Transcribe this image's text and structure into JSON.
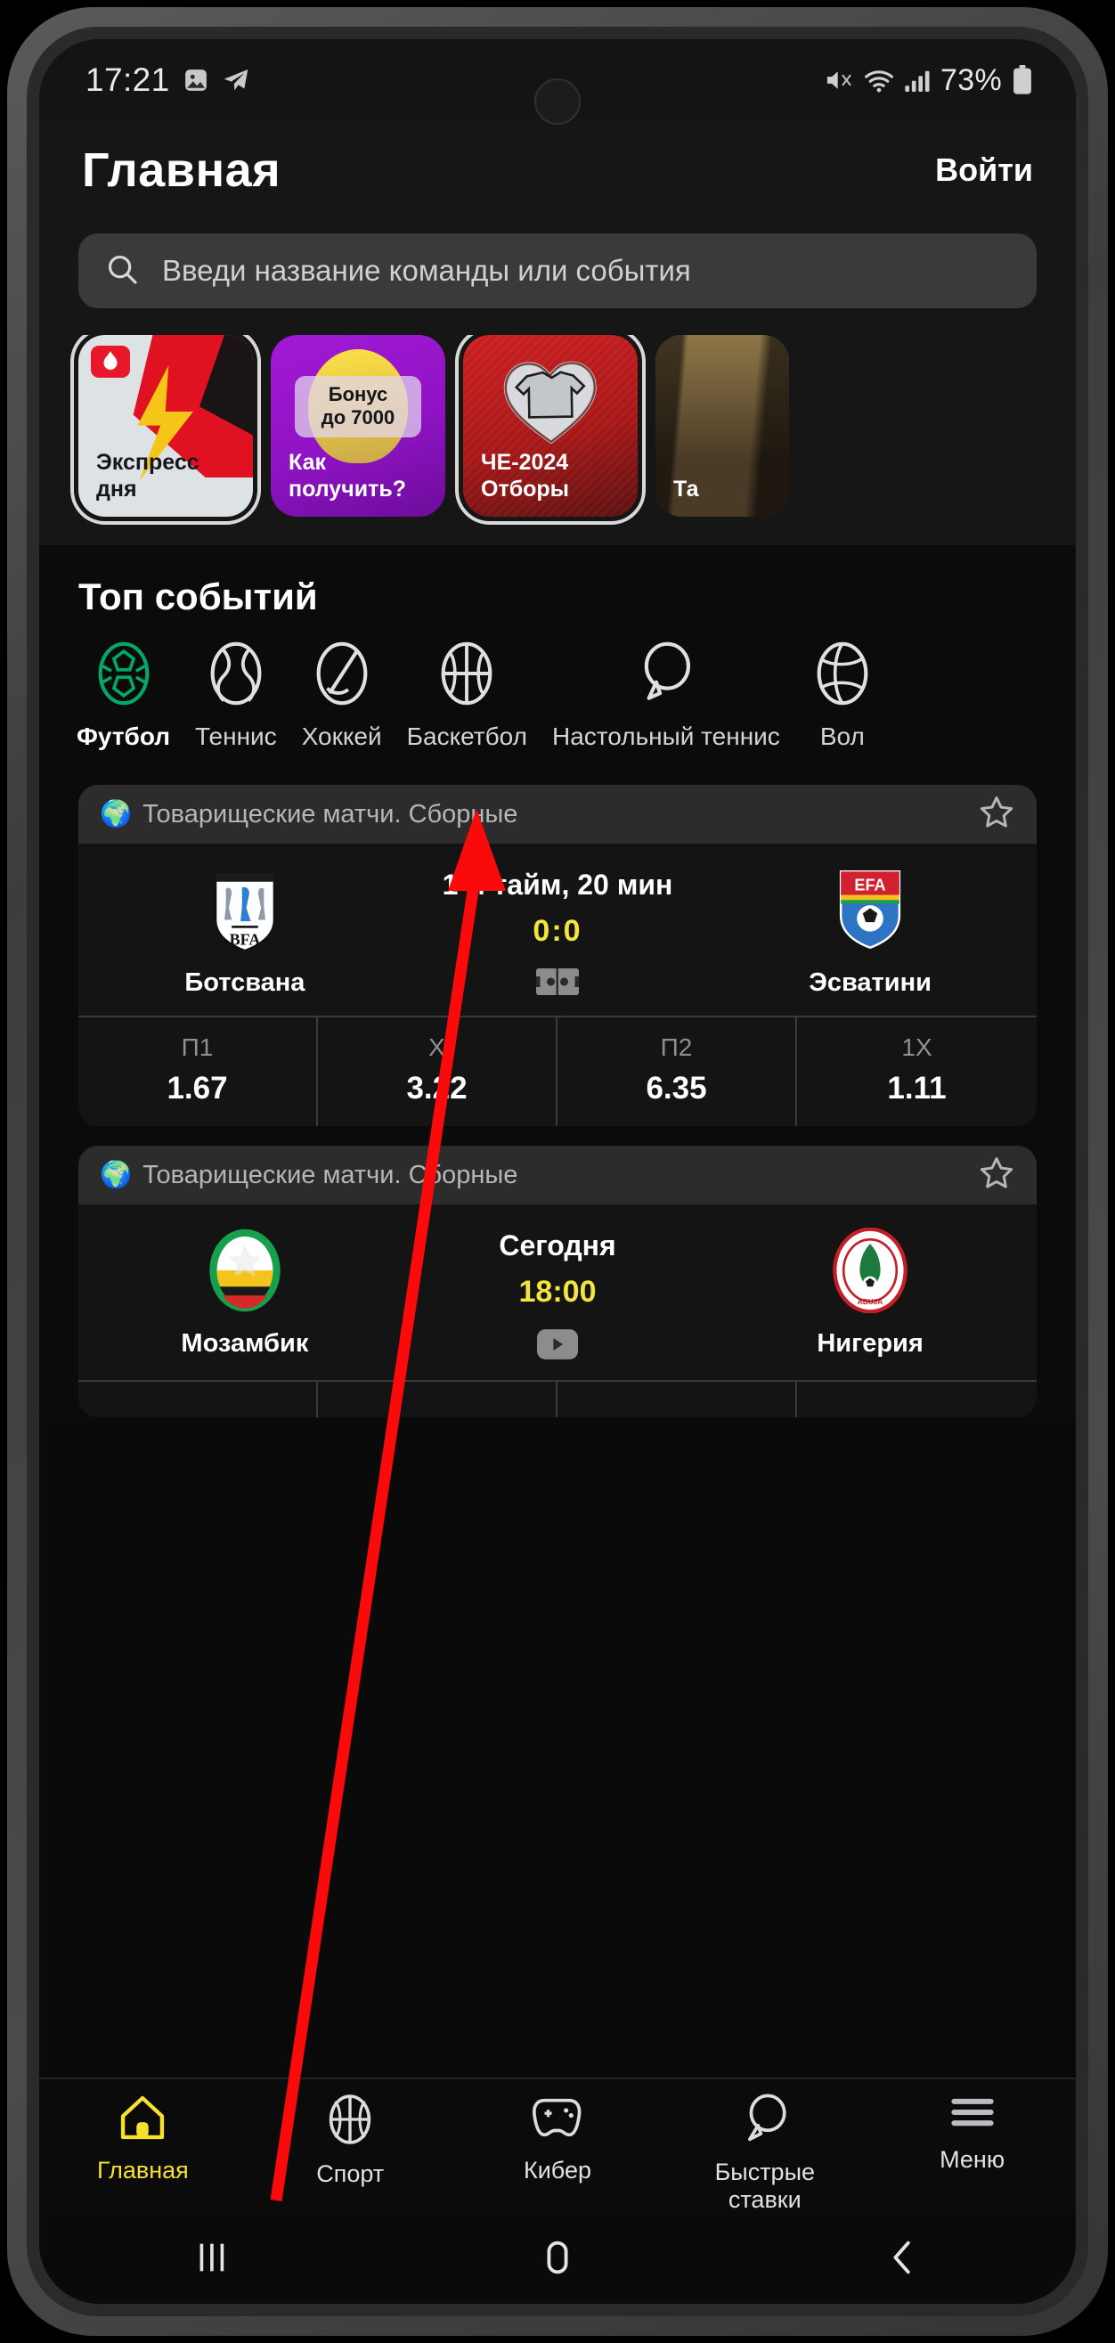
{
  "status_bar": {
    "time": "17:21",
    "left_icons": [
      "image-icon",
      "telegram-icon"
    ],
    "right_icons": [
      "mute-icon",
      "wifi-icon",
      "signal-icon"
    ],
    "battery_percent": "73%"
  },
  "header": {
    "title": "Главная",
    "login_label": "Войти"
  },
  "search": {
    "placeholder": "Введи название команды или события",
    "value": "",
    "icon": "search-icon"
  },
  "promos": [
    {
      "id": "express",
      "label": "Экспресс\nдня",
      "badge_icon": "flame-badge-icon",
      "selected": true
    },
    {
      "id": "bonus",
      "pill_text": "Бонус\nдо 7000",
      "label": "Как\nполучить?",
      "selected": false
    },
    {
      "id": "euro-2024",
      "label": "ЧЕ-2024\nОтборы",
      "icon": "heart-jersey-icon",
      "selected": true
    },
    {
      "id": "partial",
      "label": "Та",
      "selected": false
    }
  ],
  "top_events": {
    "title": "Топ событий",
    "sports": [
      {
        "label": "Футбол",
        "icon": "football-icon",
        "active": true
      },
      {
        "label": "Теннис",
        "icon": "tennis-icon",
        "active": false
      },
      {
        "label": "Хоккей",
        "icon": "hockey-puck-icon",
        "active": false
      },
      {
        "label": "Баскетбол",
        "icon": "basketball-icon",
        "active": false
      },
      {
        "label": "Настольный теннис",
        "icon": "pingpong-icon",
        "active": false
      },
      {
        "label": "Вол",
        "icon": "volleyball-icon",
        "active": false
      }
    ]
  },
  "matches": [
    {
      "league": "Товарищеские матчи. Сборные",
      "league_flag": "🌍",
      "favorite_icon": "star-outline-icon",
      "home_team": "Ботсвана",
      "home_logo": "bfa-shield-logo",
      "away_team": "Эсватини",
      "away_logo": "efa-shield-logo",
      "status": "1-й тайм, 20 мин",
      "score": "0:0",
      "media_icon": "pitch-stats-icon",
      "odds": [
        {
          "key": "П1",
          "value": "1.67"
        },
        {
          "key": "X",
          "value": "3.22"
        },
        {
          "key": "П2",
          "value": "6.35"
        },
        {
          "key": "1X",
          "value": "1.11"
        }
      ]
    },
    {
      "league": "Товарищеские матчи. Сборные",
      "league_flag": "🌍",
      "favorite_icon": "star-outline-icon",
      "home_team": "Мозамбик",
      "home_logo": "mozambique-logo",
      "away_team": "Нигерия",
      "away_logo": "nigeria-logo",
      "status": "Сегодня",
      "time": "18:00",
      "media_icon": "video-play-icon",
      "odds": []
    }
  ],
  "bottom_nav": [
    {
      "label": "Главная",
      "icon": "home-icon",
      "active": true
    },
    {
      "label": "Спорт",
      "icon": "basketball-icon",
      "active": false
    },
    {
      "label": "Кибер",
      "icon": "gamepad-icon",
      "active": false
    },
    {
      "label": "Быстрые\nставки",
      "icon": "pingpong-icon",
      "active": false
    },
    {
      "label": "Меню",
      "icon": "hamburger-icon",
      "active": false
    }
  ],
  "system_nav": [
    {
      "icon": "recents-icon"
    },
    {
      "icon": "home-pill-icon"
    },
    {
      "icon": "back-icon"
    }
  ],
  "colors": {
    "accent_yellow": "#f7e02e",
    "score_yellow": "#f2e53c",
    "active_green": "#00a96a",
    "annotation_red": "#fa0a0a",
    "screen_bg": "#0b0b0b",
    "card_bg": "#141414"
  }
}
